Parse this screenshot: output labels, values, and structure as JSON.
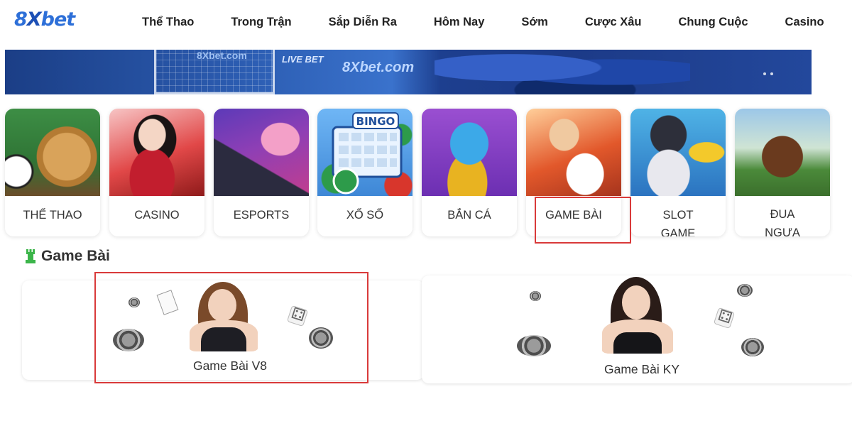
{
  "header": {
    "logo": {
      "prefix": "8",
      "x": "X",
      "suffix": "bet"
    },
    "nav": [
      "Thể Thao",
      "Trong Trận",
      "Sắp Diễn Ra",
      "Hôm Nay",
      "Sớm",
      "Cược Xâu",
      "Chung Cuộc",
      "Casino"
    ]
  },
  "banner": {
    "texts": [
      "8Xbet.com",
      "LIVE BET",
      "8Xbet.com"
    ]
  },
  "categories": [
    {
      "label": "THỂ THAO",
      "icon": "sports-icon"
    },
    {
      "label": "CASINO",
      "icon": "casino-icon"
    },
    {
      "label": "ESPORTS",
      "icon": "esports-icon"
    },
    {
      "label": "XỔ SỐ",
      "icon": "lottery-icon"
    },
    {
      "label": "BẮN CÁ",
      "icon": "fish-shooting-icon"
    },
    {
      "label": "GAME BÀI",
      "icon": "card-game-icon"
    },
    {
      "label": "SLOT GAME",
      "icon": "slot-icon"
    },
    {
      "label": "ĐUA NGỰA",
      "icon": "horse-racing-icon"
    }
  ],
  "section": {
    "title": "Game Bài",
    "icon": "rook-icon"
  },
  "games": [
    {
      "label": "Game Bài V8"
    },
    {
      "label": "Game Bài KY"
    }
  ],
  "colors": {
    "highlight": "#d93a3a",
    "logo": "#2d6fd8",
    "section_icon": "#3cb54a"
  }
}
